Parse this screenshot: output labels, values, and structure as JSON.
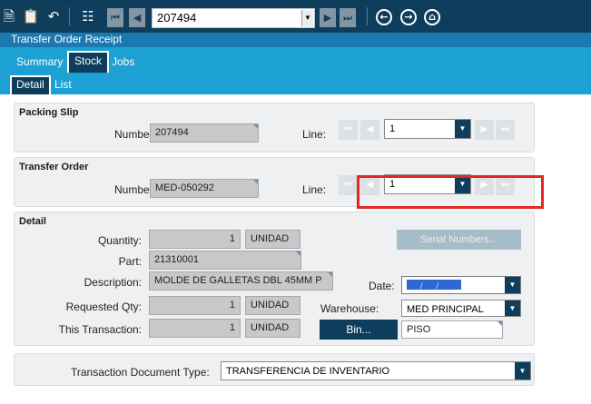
{
  "toolbar": {
    "icons": [
      "new-doc-icon",
      "clipboard-icon",
      "undo-icon",
      "binoculars-icon",
      "first-record-icon",
      "prev-record-icon",
      "next-record-icon",
      "last-record-icon",
      "back-icon",
      "forward-icon",
      "home-icon"
    ],
    "record_value": "207494"
  },
  "window_title": "Transfer Order Receipt",
  "tabs": [
    "Summary",
    "Stock",
    "Jobs"
  ],
  "subtabs": [
    "Detail",
    "List"
  ],
  "packing_slip": {
    "title": "Packing Slip",
    "number_label": "Number:",
    "number_value": "207494",
    "line_label": "Line:",
    "line_value": "1"
  },
  "transfer_order": {
    "title": "Transfer Order",
    "number_label": "Number:",
    "number_value": "MED-050292",
    "line_label": "Line:",
    "line_value": "1"
  },
  "detail": {
    "title": "Detail",
    "quantity_label": "Quantity:",
    "quantity_value": "1",
    "quantity_unit": "UNIDAD",
    "part_label": "Part:",
    "part_value": "21310001",
    "description_label": "Description:",
    "description_value": "MOLDE DE GALLETAS DBL 45MM P",
    "requested_label": "Requested Qty:",
    "requested_value": "1",
    "requested_unit": "UNIDAD",
    "this_transaction_label": "This Transaction:",
    "this_transaction_value": "1",
    "this_transaction_unit": "UNIDAD",
    "serial_numbers_button": "Serial Numbers...",
    "date_label": "Date:",
    "date_value": "___/___/___",
    "warehouse_label": "Warehouse:",
    "warehouse_value": "MED PRINCIPAL",
    "bin_button": "Bin...",
    "bin_value": "PISO"
  },
  "transaction_doc": {
    "label": "Transaction Document Type:",
    "value": "TRANSFERENCIA DE INVENTARIO"
  },
  "colors": {
    "toolbar_bg": "#0e3e5c",
    "tab_bg": "#1da0d3",
    "title_bg": "#1a79b0",
    "highlight": "#e32626"
  }
}
